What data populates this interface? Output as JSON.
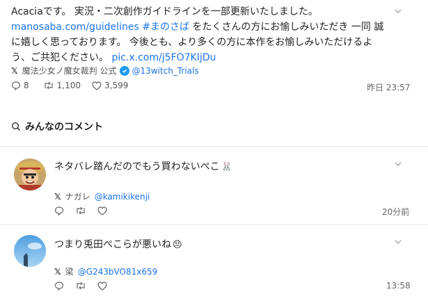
{
  "post": {
    "text_parts": {
      "intro": "Acaciaです。 実況・二次創作ガイドラインを一部更新いたしました。",
      "link": "manosaba.com/guidelines",
      "hashtag": "#まのさば",
      "mid1": " をたくさんの方にお愉しみいただき 一同 誠",
      "mid2": "に嬉しく思っております。 今後とも、より多くの方に本作をお愉しみいただけるよ",
      "mid3": "う、ご共犯ください。 ",
      "pic_link": "pic.x.com/j5FO7KIjDu"
    },
    "author_name": "魔法少女ノ魔女裁判 公式",
    "author_handle": "@13witch_Trials",
    "replies": "8",
    "reposts": "1,100",
    "likes": "3,599",
    "time": "昨日 23:57"
  },
  "section": {
    "title": "みんなのコメント"
  },
  "comments": [
    {
      "text": "ネタバレ踏んだのでもう買わないぺこ",
      "emoji": "🐰",
      "author_name": "ナガレ",
      "author_handle": "@kamikikenji",
      "time": "20分前"
    },
    {
      "text": "つまり兎田ぺこらが悪いね",
      "emoji": "😣",
      "author_name": "梁",
      "author_handle": "@G243bVO81x659",
      "time": "13:58"
    }
  ],
  "colors": {
    "link": "#1a73e8",
    "verified": "#1d9bf0",
    "divider": "#e8e8e8"
  }
}
